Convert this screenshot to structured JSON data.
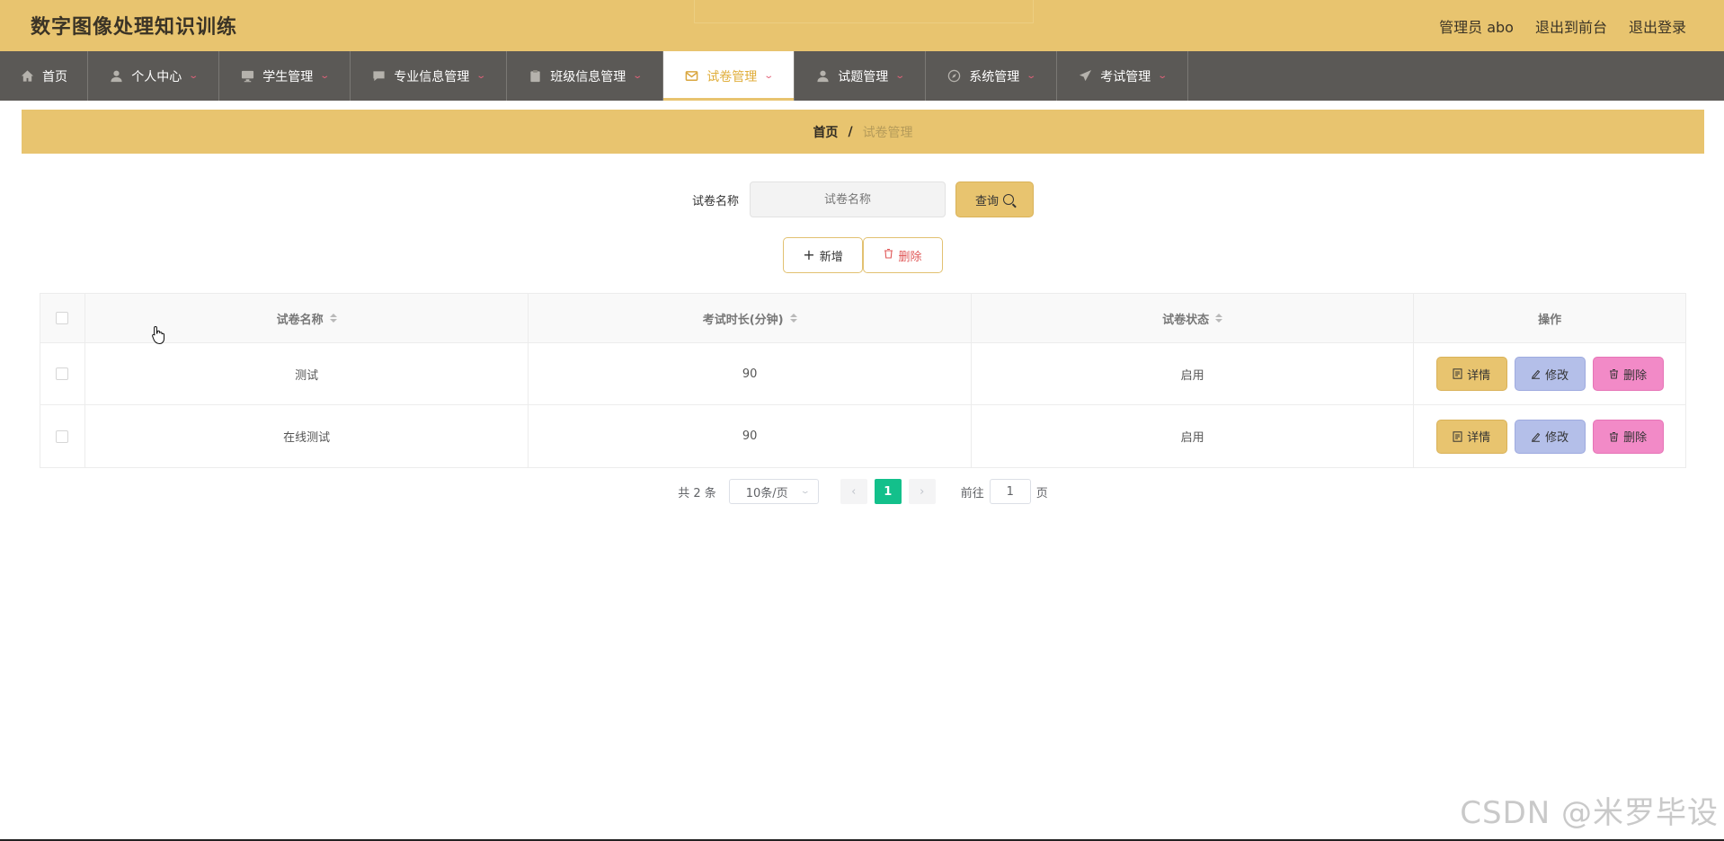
{
  "header": {
    "title": "数字图像处理知识训练",
    "user": "管理员 abo",
    "front_link": "退出到前台",
    "logout_link": "退出登录"
  },
  "nav": [
    {
      "label": "首页",
      "icon": "home-icon"
    },
    {
      "label": "个人中心",
      "icon": "person-icon"
    },
    {
      "label": "学生管理",
      "icon": "monitor-icon"
    },
    {
      "label": "专业信息管理",
      "icon": "chat-icon"
    },
    {
      "label": "班级信息管理",
      "icon": "clipboard-icon"
    },
    {
      "label": "试卷管理",
      "icon": "mail-icon",
      "active": true
    },
    {
      "label": "试题管理",
      "icon": "person-icon"
    },
    {
      "label": "系统管理",
      "icon": "compass-icon"
    },
    {
      "label": "考试管理",
      "icon": "send-icon"
    }
  ],
  "breadcrumb": {
    "home": "首页",
    "sep": "/",
    "current": "试卷管理"
  },
  "search": {
    "label": "试卷名称",
    "placeholder": "试卷名称",
    "button": "查询"
  },
  "actions": {
    "add": "新增",
    "delete": "删除"
  },
  "table": {
    "headers": [
      "试卷名称",
      "考试时长(分钟)",
      "试卷状态",
      "操作"
    ],
    "rows": [
      {
        "name": "测试",
        "duration": "90",
        "status": "启用"
      },
      {
        "name": "在线测试",
        "duration": "90",
        "status": "启用"
      }
    ],
    "ops": {
      "detail": "详情",
      "edit": "修改",
      "remove": "删除"
    }
  },
  "pager": {
    "total": "共 2 条",
    "page_size": "10条/页",
    "current_page": "1",
    "goto_label": "前往",
    "goto_value": "1",
    "goto_suffix": "页"
  },
  "watermark": "CSDN @米罗毕设",
  "colors": {
    "accent": "#e8c46f",
    "nav_bg": "#5b5956",
    "page_active": "#13c08b",
    "edit": "#b4bfe9",
    "remove": "#f28ac7"
  }
}
